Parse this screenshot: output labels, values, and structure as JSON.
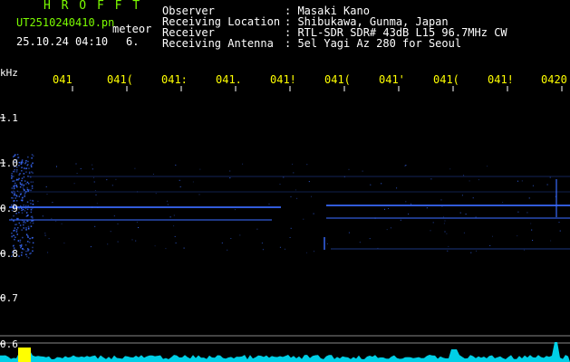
{
  "brand": "H R O F F T",
  "filename": "UT2510240410.pn",
  "meteor_label": "meteor",
  "datetime": "25.10.24 04:10",
  "count": "6.",
  "header": [
    {
      "label": "Observer",
      "value": ": Masaki Kano"
    },
    {
      "label": "Receiving Location",
      "value": ": Shibukawa, Gunma, Japan"
    },
    {
      "label": "Receiver",
      "value": ": RTL-SDR SDR# 43dB L15 96.7MHz CW"
    },
    {
      "label": "Receiving Antenna",
      "value": ": 5el Yagi Az 280 for Seoul"
    }
  ],
  "y_axis": {
    "unit": "kHz",
    "ticks": [
      "1.1",
      "1.0",
      "0.9",
      "0.8",
      "0.7",
      "0.6"
    ]
  },
  "time_ticks": [
    "041",
    "041(",
    "041:",
    "041.",
    "041!",
    "041(",
    "041'",
    "041(",
    "041!",
    "0420"
  ],
  "colors": {
    "background": "#000000",
    "header_text": "#ffffff",
    "brand_text": "#7CFC00",
    "time_ticks": "#ffff00",
    "signal": "#3a6cff",
    "level_trace": "#00e5ff"
  }
}
